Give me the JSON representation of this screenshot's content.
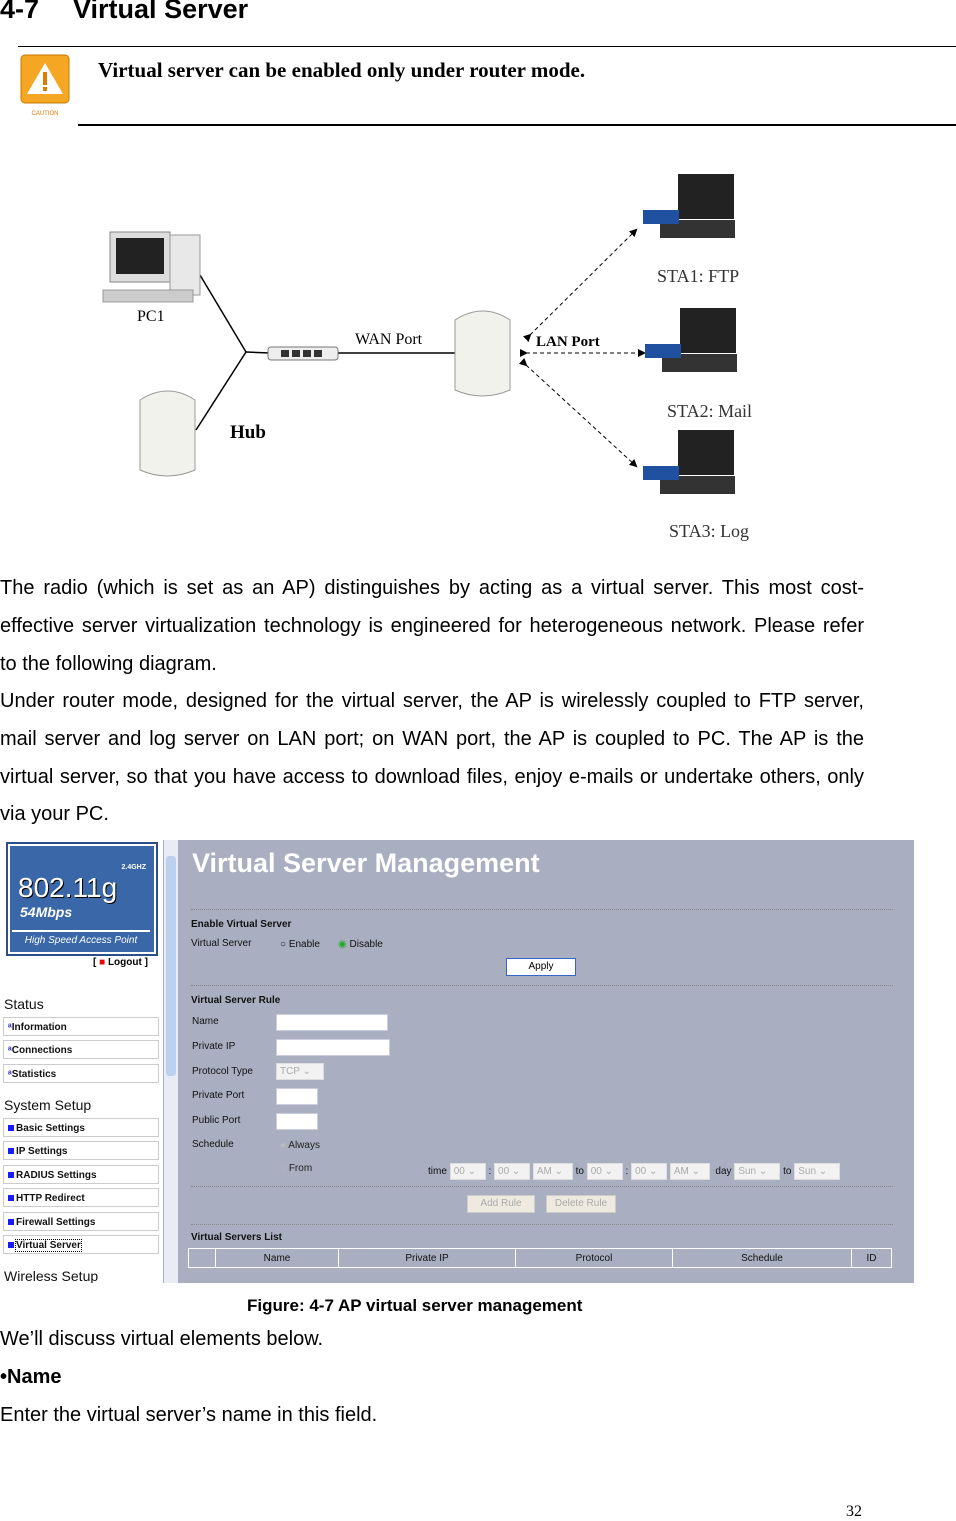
{
  "heading": {
    "number": "4-7",
    "title": "Virtual Server"
  },
  "caution": {
    "icon": "caution-icon",
    "icon_label": "CAUTION",
    "text": "Virtual server can be enabled only under router mode."
  },
  "diagram": {
    "pc": "PC1",
    "hub": "Hub",
    "wan": "WAN Port",
    "lan": "LAN Port",
    "sta1": "STA1: FTP",
    "sta2": "STA2: Mail",
    "sta3": "STA3: Log"
  },
  "paragraphs": [
    "The radio (which is set as an AP) distinguishes by acting as a virtual server. This most cost-effective server virtualization technology is engineered for heterogeneous network. Please refer to the following diagram.",
    "Under router mode, designed for the virtual server, the AP is wirelessly coupled to FTP server, mail server and log server on LAN port; on WAN port, the AP is coupled to PC. The AP is the virtual server, so that you have access to download files, enjoy e-mails or undertake others, only via your PC."
  ],
  "ui": {
    "logo": {
      "band": "2.4GHZ",
      "std": "802.11g",
      "rate": "54Mbps",
      "tagline": "High Speed Access Point"
    },
    "logout": "Logout",
    "status_title": "Status",
    "status_items": [
      "Information",
      "Connections",
      "Statistics"
    ],
    "setup_title": "System Setup",
    "setup_items": [
      "Basic Settings",
      "IP Settings",
      "RADIUS Settings",
      "HTTP Redirect",
      "Firewall Settings",
      "Virtual Server"
    ],
    "wireless_title": "Wireless Setup",
    "page_title": "Virtual Server Management",
    "enable_section": "Enable Virtual Server",
    "vs_label": "Virtual Server",
    "enable": "Enable",
    "disable": "Disable",
    "apply": "Apply",
    "rule_section": "Virtual Server Rule",
    "name": "Name",
    "private_ip": "Private IP",
    "protocol_type": "Protocol Type",
    "protocol_value": "TCP",
    "private_port": "Private Port",
    "public_port": "Public Port",
    "schedule": "Schedule",
    "always": "Always",
    "from": "From",
    "time": "time",
    "to": "to",
    "day": "day",
    "colon": ":",
    "hh": "00",
    "mm": "00",
    "ampm": "AM",
    "dayval": "Sun",
    "add_rule": "Add Rule",
    "delete_rule": "Delete Rule",
    "list_section": "Virtual Servers List",
    "columns": [
      "",
      "Name",
      "Private IP",
      "Protocol",
      "Schedule",
      "ID"
    ]
  },
  "caption": "Figure: 4-7 AP virtual server management",
  "after": "We’ll discuss virtual elements below.",
  "bullet": "•Name",
  "bullet_text": "Enter the virtual server’s name in this field.",
  "page_number": "32"
}
